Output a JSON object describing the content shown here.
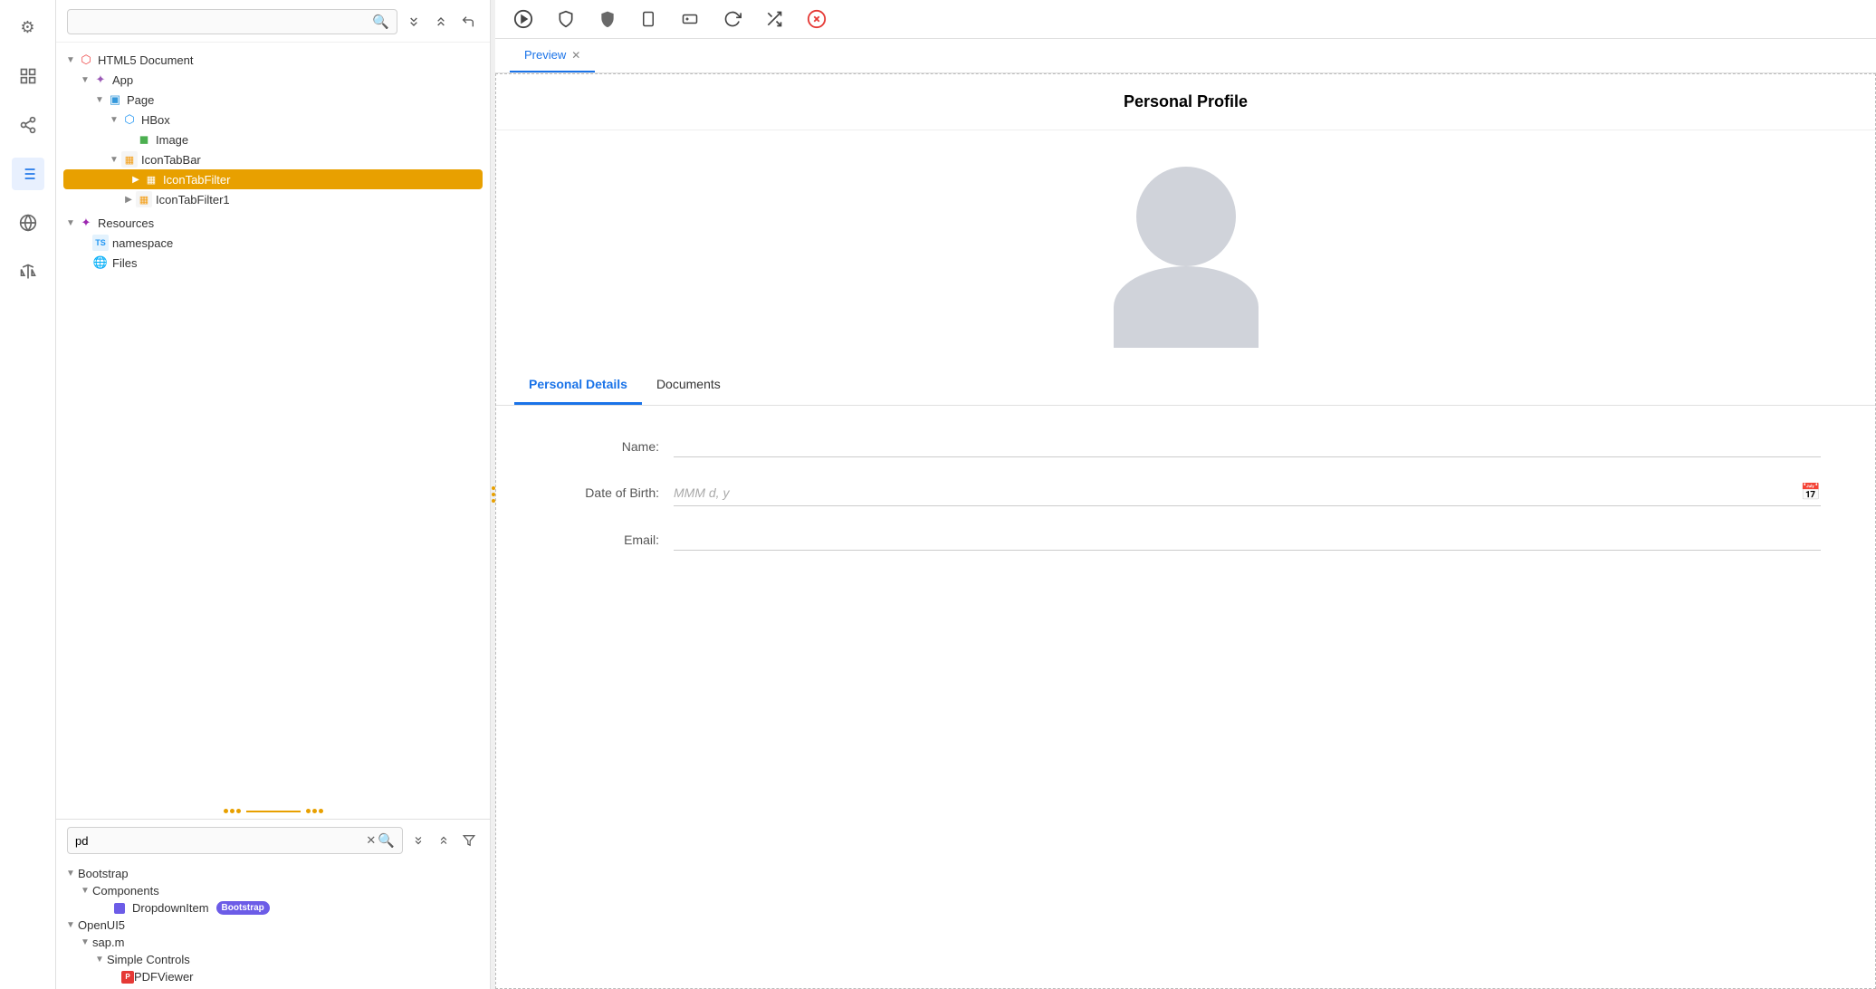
{
  "iconBar": {
    "items": [
      {
        "name": "settings",
        "icon": "⚙",
        "active": false
      },
      {
        "name": "layers",
        "icon": "🔲",
        "active": false
      },
      {
        "name": "share",
        "icon": "↗",
        "active": false
      },
      {
        "name": "list",
        "icon": "☰",
        "active": true
      },
      {
        "name": "globe",
        "icon": "🌐",
        "active": false
      },
      {
        "name": "balance",
        "icon": "⚖",
        "active": false
      }
    ]
  },
  "topSearch": {
    "placeholder": ""
  },
  "tree": {
    "items": [
      {
        "id": "html5doc",
        "label": "HTML5 Document",
        "indent": 0,
        "icon": "html",
        "arrow": "▼",
        "type": "root"
      },
      {
        "id": "app",
        "label": "App",
        "indent": 1,
        "icon": "app",
        "arrow": "▼",
        "type": "node"
      },
      {
        "id": "page",
        "label": "Page",
        "indent": 2,
        "icon": "page",
        "arrow": "▼",
        "type": "node"
      },
      {
        "id": "hbox",
        "label": "HBox",
        "indent": 3,
        "icon": "hbox",
        "arrow": "▼",
        "type": "node"
      },
      {
        "id": "image",
        "label": "Image",
        "indent": 4,
        "icon": "image",
        "arrow": "",
        "type": "leaf"
      },
      {
        "id": "icontabbar",
        "label": "IconTabBar",
        "indent": 3,
        "icon": "tabbar",
        "arrow": "▼",
        "type": "node"
      },
      {
        "id": "icontabfilter",
        "label": "IconTabFilter",
        "indent": 4,
        "icon": "tabfilter",
        "arrow": "▶",
        "type": "selected"
      },
      {
        "id": "icontabfilter1",
        "label": "IconTabFilter1",
        "indent": 4,
        "icon": "tabfilter",
        "arrow": "▶",
        "type": "node"
      },
      {
        "id": "resources",
        "label": "Resources",
        "indent": 0,
        "icon": "resources",
        "arrow": "▼",
        "type": "root"
      },
      {
        "id": "namespace",
        "label": "namespace",
        "indent": 1,
        "icon": "ts",
        "arrow": "",
        "type": "leaf"
      },
      {
        "id": "files",
        "label": "Files",
        "indent": 1,
        "icon": "files",
        "arrow": "",
        "type": "leaf"
      }
    ]
  },
  "bottomSearch": {
    "value": "pd",
    "placeholder": ""
  },
  "library": {
    "items": [
      {
        "id": "bootstrap",
        "label": "Bootstrap",
        "indent": 0,
        "arrow": "▼"
      },
      {
        "id": "components",
        "label": "Components",
        "indent": 1,
        "arrow": "▼"
      },
      {
        "id": "dropdownitem",
        "label": "DropdownItem",
        "indent": 2,
        "arrow": "",
        "badge": "Bootstrap"
      },
      {
        "id": "openui5",
        "label": "OpenUI5",
        "indent": 0,
        "arrow": "▼"
      },
      {
        "id": "sapm",
        "label": "sap.m",
        "indent": 1,
        "arrow": "▼"
      },
      {
        "id": "simplecontrols",
        "label": "Simple Controls",
        "indent": 2,
        "arrow": "▼"
      },
      {
        "id": "pdfviewer",
        "label": "PDFViewer",
        "indent": 3,
        "arrow": "",
        "badge": null
      }
    ]
  },
  "previewToolbar": {
    "icons": [
      "play",
      "shield",
      "shield2",
      "mobile",
      "gamepad",
      "refresh",
      "shuffle",
      "close"
    ]
  },
  "tabs": [
    {
      "label": "Preview",
      "active": true,
      "closeable": true
    }
  ],
  "preview": {
    "title": "Personal Profile",
    "tabs": [
      {
        "label": "Personal Details",
        "active": true
      },
      {
        "label": "Documents",
        "active": false
      }
    ],
    "form": {
      "fields": [
        {
          "label": "Name:",
          "value": "",
          "placeholder": "",
          "type": "text",
          "hasCalendar": false
        },
        {
          "label": "Date of Birth:",
          "value": "",
          "placeholder": "MMM d, y",
          "type": "date",
          "hasCalendar": true
        },
        {
          "label": "Email:",
          "value": "",
          "placeholder": "",
          "type": "text",
          "hasCalendar": false
        }
      ]
    }
  }
}
